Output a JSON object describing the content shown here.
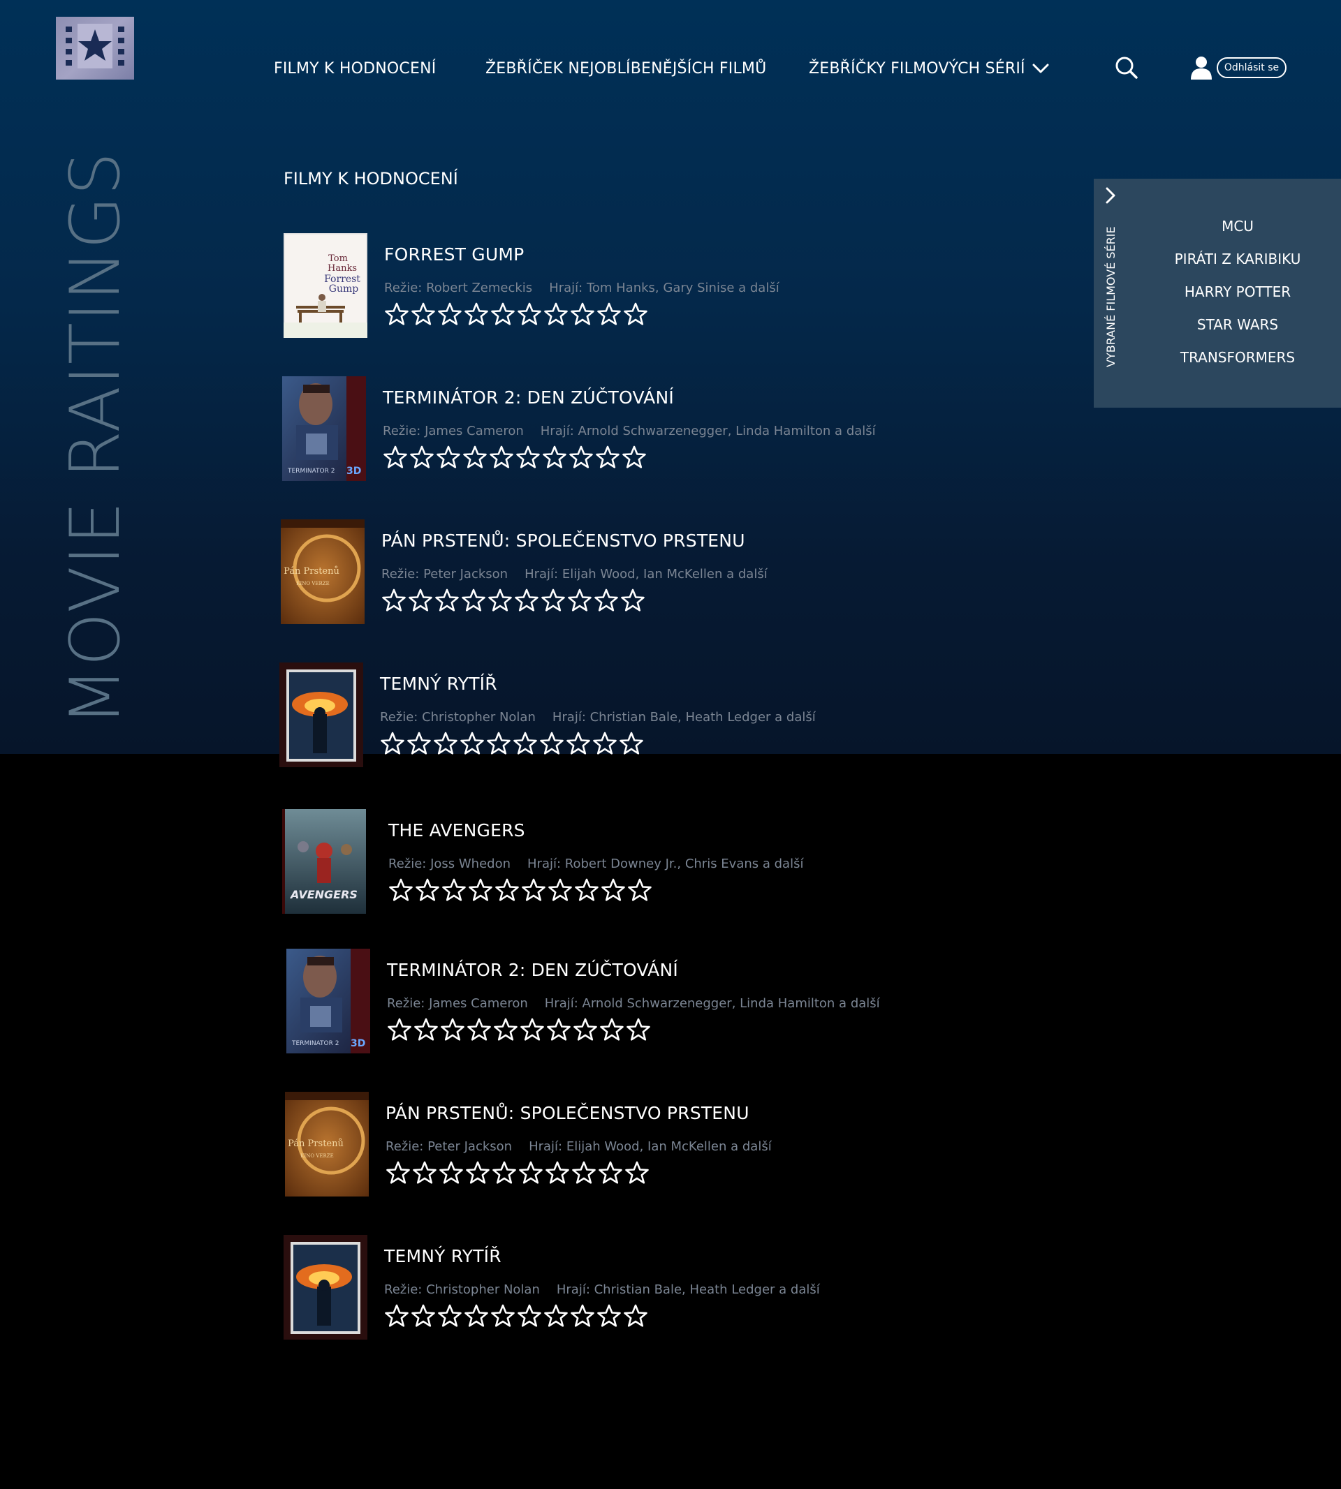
{
  "brand": {
    "vertical_title": "MOVIE RAITINGS",
    "logo_icon": "film-star-icon"
  },
  "nav": {
    "items": [
      {
        "label": "FILMY K HODNOCENÍ"
      },
      {
        "label": "ŽEBŘÍČEK NEJOBLÍBENĚJŠÍCH FILMŮ"
      },
      {
        "label": "ŽEBŘÍČKY FILMOVÝCH SÉRIÍ"
      }
    ],
    "search_icon": "search-icon",
    "user_icon": "user-icon",
    "logout_label": "Odhlásit se"
  },
  "section_title": "FILMY K HODNOCENÍ",
  "movies": [
    {
      "title": "FORREST GUMP",
      "director": "Režie: Robert Zemeckis",
      "actors": "Hrají: Tom Hanks, Gary Sinise a další",
      "rating": 0,
      "max_rating": 10
    },
    {
      "title": "TERMINÁTOR 2: DEN ZÚČTOVÁNÍ",
      "director": "Režie: James Cameron",
      "actors": "Hrají: Arnold Schwarzenegger, Linda Hamilton a další",
      "rating": 0,
      "max_rating": 10
    },
    {
      "title": "PÁN PRSTENŮ: SPOLEČENSTVO PRSTENU",
      "director": "Režie: Peter Jackson",
      "actors": "Hrají: Elijah Wood, Ian McKellen a další",
      "rating": 0,
      "max_rating": 10
    },
    {
      "title": "TEMNÝ RYTÍŘ",
      "director": "Režie: Christopher Nolan",
      "actors": "Hrají: Christian Bale, Heath Ledger a další",
      "rating": 0,
      "max_rating": 10
    },
    {
      "title": "THE AVENGERS",
      "director": "Režie: Joss Whedon",
      "actors": "Hrají: Robert Downey Jr., Chris Evans a další",
      "rating": 0,
      "max_rating": 10
    },
    {
      "title": "TERMINÁTOR 2: DEN ZÚČTOVÁNÍ",
      "director": "Režie: James Cameron",
      "actors": "Hrají: Arnold Schwarzenegger, Linda Hamilton a další",
      "rating": 0,
      "max_rating": 10
    },
    {
      "title": "PÁN PRSTENŮ: SPOLEČENSTVO PRSTENU",
      "director": "Režie: Peter Jackson",
      "actors": "Hrají: Elijah Wood, Ian McKellen a další",
      "rating": 0,
      "max_rating": 10
    },
    {
      "title": "TEMNÝ RYTÍŘ",
      "director": "Režie: Christopher Nolan",
      "actors": "Hrají: Christian Bale, Heath Ledger a další",
      "rating": 0,
      "max_rating": 10
    }
  ],
  "side_panel": {
    "vertical_label": "VYBRANÉ FILMOVÉ SÉRIE",
    "series": [
      "MCU",
      "PIRÁTI Z KARIBIKU",
      "HARRY POTTER",
      "STAR WARS",
      "TRANSFORMERS"
    ]
  },
  "colors": {
    "bg_top": "#003057",
    "bg_bottom": "#000000",
    "side_panel": "#2c475e",
    "brand_text": "#587185",
    "meta_text": "#7b8593"
  }
}
